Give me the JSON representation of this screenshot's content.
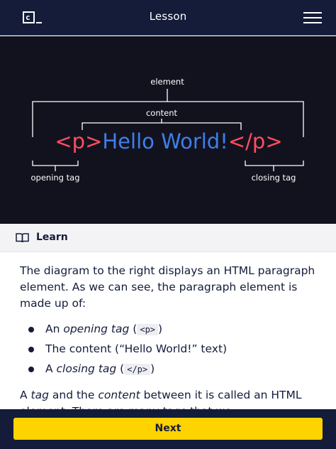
{
  "header": {
    "logo_text": "c",
    "title": "Lesson",
    "menu_icon": "hamburger-menu-icon"
  },
  "diagram": {
    "label_element": "element",
    "label_content": "content",
    "label_opening": "opening tag",
    "label_closing": "closing tag",
    "open_tag": "<p>",
    "inner_text": "Hello World!",
    "close_tag": "</p>",
    "colors": {
      "tag": "#ff4d5e",
      "text": "#3f7fe8",
      "label": "#ffffff",
      "bracket": "#ffffff"
    }
  },
  "learn": {
    "icon": "book-icon",
    "label": "Learn"
  },
  "content": {
    "intro": "The diagram to the right displays an HTML paragraph element. As we can see, the paragraph element is made up of:",
    "bullets": [
      {
        "prefix": "An ",
        "em": "opening tag",
        "mid": " (",
        "code": "<p>",
        "suffix": ")"
      },
      {
        "text": "The content (“Hello World!” text)"
      },
      {
        "prefix": "A ",
        "em": "closing tag",
        "mid": " (",
        "code": "</p>",
        "suffix": ")"
      }
    ],
    "para2_a": "A ",
    "para2_em1": "tag",
    "para2_b": " and the ",
    "para2_em2": "content",
    "para2_c": " between it is called an HTML element. There are many tags that we"
  },
  "footer": {
    "next_label": "Next"
  },
  "colors": {
    "navy": "#141c3a",
    "accent_yellow": "#ffd300"
  }
}
